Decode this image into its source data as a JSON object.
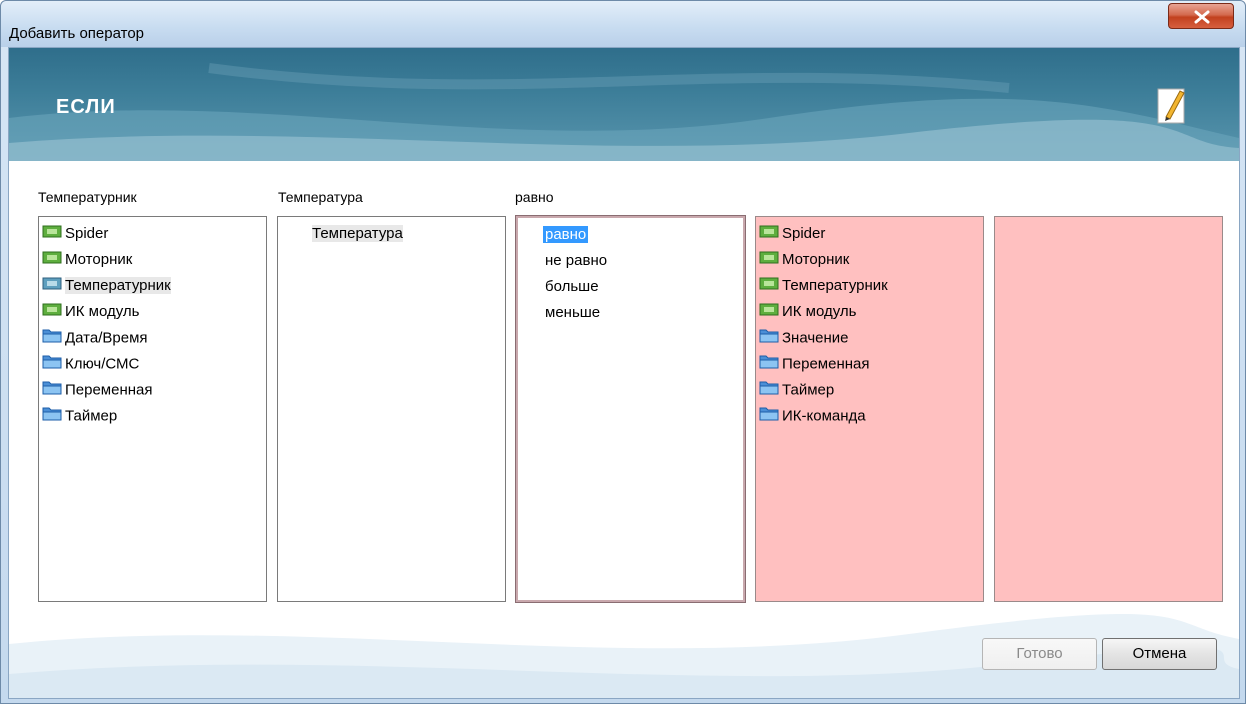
{
  "window": {
    "title": "Добавить оператор"
  },
  "banner": {
    "title": "ЕСЛИ"
  },
  "columns": [
    {
      "label": "Температурник",
      "items": [
        {
          "label": "Spider",
          "icon": "device-icon"
        },
        {
          "label": "Моторник",
          "icon": "device-icon"
        },
        {
          "label": "Температурник",
          "icon": "device-icon",
          "state": "highlighted"
        },
        {
          "label": "ИК модуль",
          "icon": "device-icon"
        },
        {
          "label": "Дата/Время",
          "icon": "folder-icon"
        },
        {
          "label": "Ключ/СМС",
          "icon": "folder-icon"
        },
        {
          "label": "Переменная",
          "icon": "folder-icon"
        },
        {
          "label": "Таймер",
          "icon": "folder-icon"
        }
      ]
    },
    {
      "label": "Температура",
      "items": [
        {
          "label": "Температура",
          "state": "highlighted"
        }
      ]
    },
    {
      "label": "равно",
      "items": [
        {
          "label": "равно",
          "state": "selected"
        },
        {
          "label": "не равно"
        },
        {
          "label": "больше"
        },
        {
          "label": "меньше"
        }
      ]
    },
    {
      "label": "",
      "items": [
        {
          "label": "Spider",
          "icon": "device-icon"
        },
        {
          "label": "Моторник",
          "icon": "device-icon"
        },
        {
          "label": "Температурник",
          "icon": "device-icon"
        },
        {
          "label": "ИК модуль",
          "icon": "device-icon"
        },
        {
          "label": "Значение",
          "icon": "folder-icon"
        },
        {
          "label": "Переменная",
          "icon": "folder-icon"
        },
        {
          "label": "Таймер",
          "icon": "folder-icon"
        },
        {
          "label": "ИК-команда",
          "icon": "folder-icon"
        }
      ]
    },
    {
      "label": "",
      "items": []
    }
  ],
  "buttons": {
    "done": "Готово",
    "cancel": "Отмена"
  },
  "colors": {
    "banner": "#3d7e99",
    "pink_panel": "#ffc0c0",
    "selection": "#3399ff"
  }
}
